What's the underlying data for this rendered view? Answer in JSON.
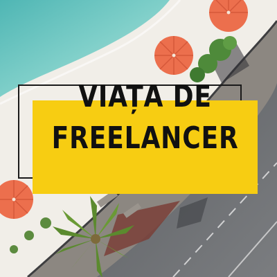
{
  "poster": {
    "title_line_1": "VIAȚA DE",
    "title_line_2": "FREELANCER"
  },
  "colors": {
    "banner_yellow": "#f7cd12",
    "sea": "#6fc4c1",
    "sand": "#f1eee8",
    "umbrella": "#ec6f4d",
    "road": "#6b6e72",
    "title_text": "#111111"
  },
  "icons": [
    "beach-umbrella-icon",
    "palm-tree-icon"
  ]
}
